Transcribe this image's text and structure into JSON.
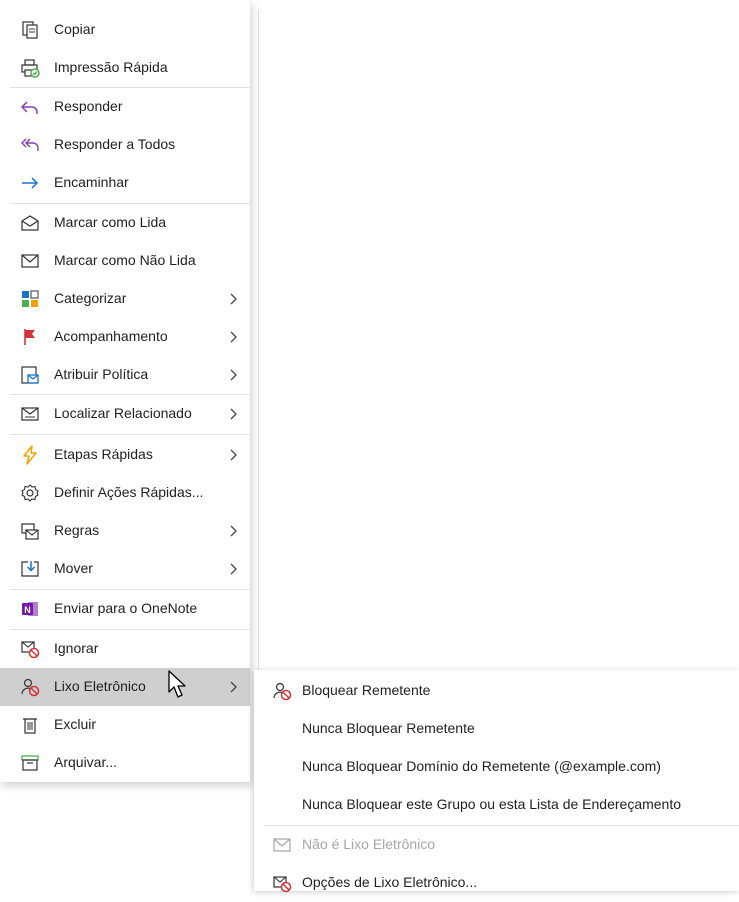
{
  "menu": {
    "items": [
      {
        "label": "Copiar",
        "icon": "copy-icon",
        "submenu": false
      },
      {
        "label": "Impressão Rápida",
        "icon": "quick-print-icon",
        "submenu": false
      },
      {
        "label": "Responder",
        "icon": "reply-icon",
        "submenu": false
      },
      {
        "label": "Responder a Todos",
        "icon": "reply-all-icon",
        "submenu": false
      },
      {
        "label": "Encaminhar",
        "icon": "forward-icon",
        "submenu": false
      },
      {
        "label": "Marcar como Lida",
        "icon": "mark-read-icon",
        "submenu": false
      },
      {
        "label": "Marcar como Não Lida",
        "icon": "mark-unread-icon",
        "submenu": false
      },
      {
        "label": "Categorizar",
        "icon": "categorize-icon",
        "submenu": true
      },
      {
        "label": "Acompanhamento",
        "icon": "flag-icon",
        "submenu": true
      },
      {
        "label": "Atribuir Política",
        "icon": "assign-policy-icon",
        "submenu": true
      },
      {
        "label": "Localizar Relacionado",
        "icon": "find-related-icon",
        "submenu": true
      },
      {
        "label": "Etapas Rápidas",
        "icon": "quick-steps-icon",
        "submenu": true
      },
      {
        "label": "Definir Ações Rápidas...",
        "icon": "gear-icon",
        "submenu": false
      },
      {
        "label": "Regras",
        "icon": "rules-icon",
        "submenu": true
      },
      {
        "label": "Mover",
        "icon": "move-icon",
        "submenu": true
      },
      {
        "label": "Enviar para o OneNote",
        "icon": "onenote-icon",
        "submenu": false
      },
      {
        "label": "Ignorar",
        "icon": "ignore-icon",
        "submenu": false
      },
      {
        "label": "Lixo Eletrônico",
        "icon": "junk-icon",
        "submenu": true,
        "highlighted": true
      },
      {
        "label": "Excluir",
        "icon": "delete-icon",
        "submenu": false
      },
      {
        "label": "Arquivar...",
        "icon": "archive-icon",
        "submenu": false
      }
    ]
  },
  "submenu": {
    "items": [
      {
        "label": "Bloquear Remetente",
        "icon": "block-sender-icon",
        "enabled": true
      },
      {
        "label": "Nunca Bloquear Remetente",
        "enabled": true
      },
      {
        "label": "Nunca Bloquear Domínio do Remetente (@example.com)",
        "enabled": true
      },
      {
        "label": "Nunca Bloquear este Grupo ou esta Lista de Endereçamento",
        "enabled": true
      },
      {
        "label": "Não é Lixo Eletrônico",
        "icon": "not-junk-icon",
        "enabled": false
      },
      {
        "label": "Opções de Lixo Eletrônico...",
        "icon": "junk-options-icon",
        "enabled": true
      }
    ]
  },
  "colors": {
    "accent_blue": "#1a73c8",
    "purple": "#8b3fb3",
    "red": "#d13438",
    "green": "#4caf50",
    "orange": "#f0a30a",
    "onenote": "#7719aa",
    "hover_bg": "#cfcfcf"
  }
}
